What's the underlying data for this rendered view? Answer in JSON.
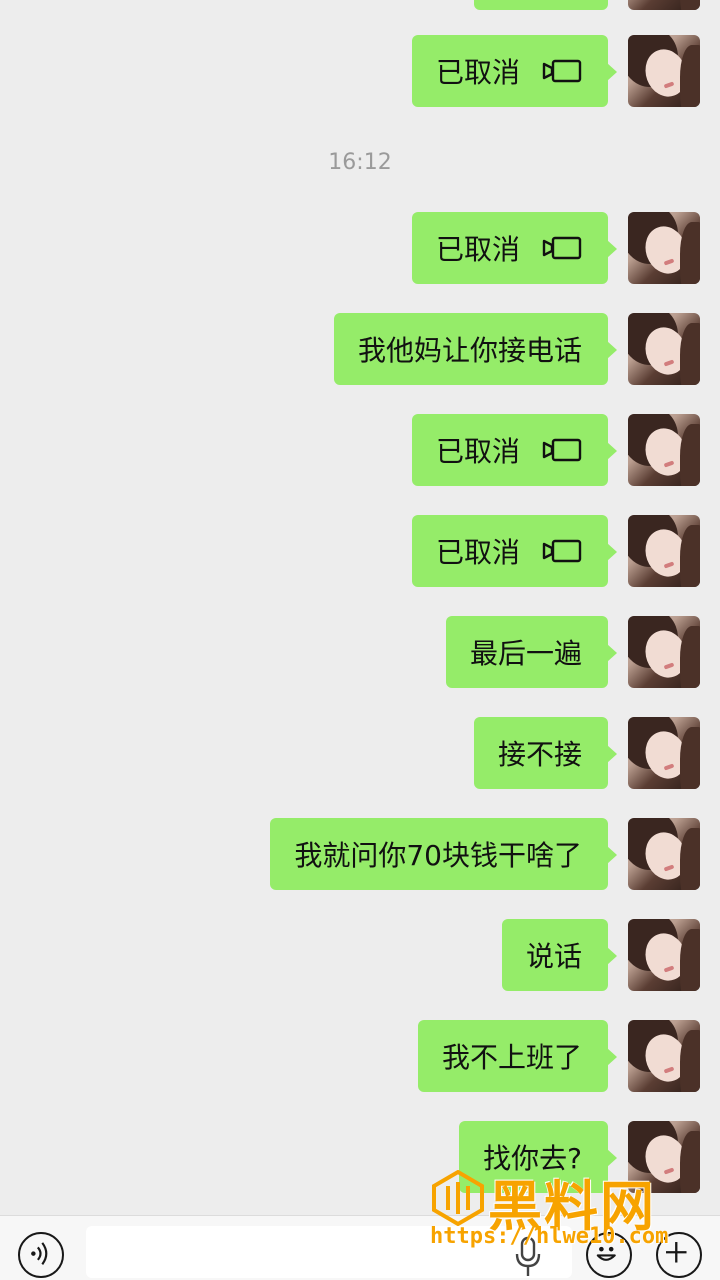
{
  "timestamp": "16:12",
  "messages": [
    {
      "text": "",
      "type": "text"
    },
    {
      "text": "已取消",
      "type": "video-call"
    },
    {
      "text": "已取消",
      "type": "video-call"
    },
    {
      "text": "我他妈让你接电话",
      "type": "text"
    },
    {
      "text": "已取消",
      "type": "video-call"
    },
    {
      "text": "已取消",
      "type": "video-call"
    },
    {
      "text": "最后一遍",
      "type": "text"
    },
    {
      "text": "接不接",
      "type": "text"
    },
    {
      "text": "我就问你70块钱干啥了",
      "type": "text"
    },
    {
      "text": "说话",
      "type": "text"
    },
    {
      "text": "我不上班了",
      "type": "text"
    },
    {
      "text": "找你去?",
      "type": "text"
    }
  ],
  "colors": {
    "bubble": "#95ec69",
    "background": "#ededed",
    "watermark": "#f7a300"
  },
  "input_bar": {
    "icons": [
      "voice-icon",
      "microphone-icon",
      "emoji-icon",
      "plus-icon"
    ]
  },
  "watermark": {
    "title": "黑料网",
    "url": "https://hlwe10.com"
  }
}
